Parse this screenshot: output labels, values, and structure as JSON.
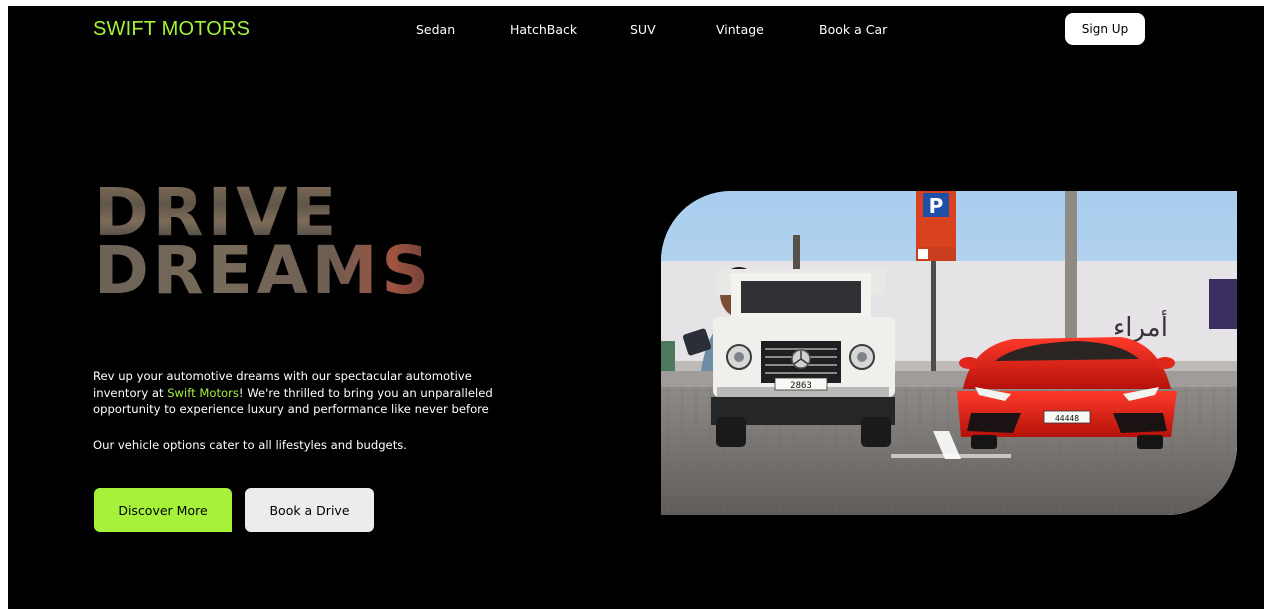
{
  "nav": {
    "brand": "SWIFT MOTORS",
    "links": [
      "Sedan",
      "HatchBack",
      "SUV",
      "Vintage",
      "Book a Car"
    ],
    "signup_label": "Sign Up"
  },
  "hero": {
    "title_line1": "DRIVE",
    "title_line2": "DREAMS",
    "desc_before": "Rev up your automotive dreams with our spectacular automotive inventory at ",
    "desc_brand": "Swift Motors",
    "desc_after": "! We're thrilled to bring you an unparalleled opportunity to experience luxury and performance like never before",
    "desc_second": "Our vehicle options cater to all lifestyles and budgets.",
    "discover_label": "Discover More",
    "book_drive_label": "Book a Drive"
  },
  "colors": {
    "accent": "#a6f23a",
    "background": "#000000",
    "button_light": "#ececec"
  },
  "image": {
    "parking_sign": "P",
    "g_wagon_plate": "2863",
    "lambo_plate": "44448",
    "billboard_text": "أمراء"
  }
}
